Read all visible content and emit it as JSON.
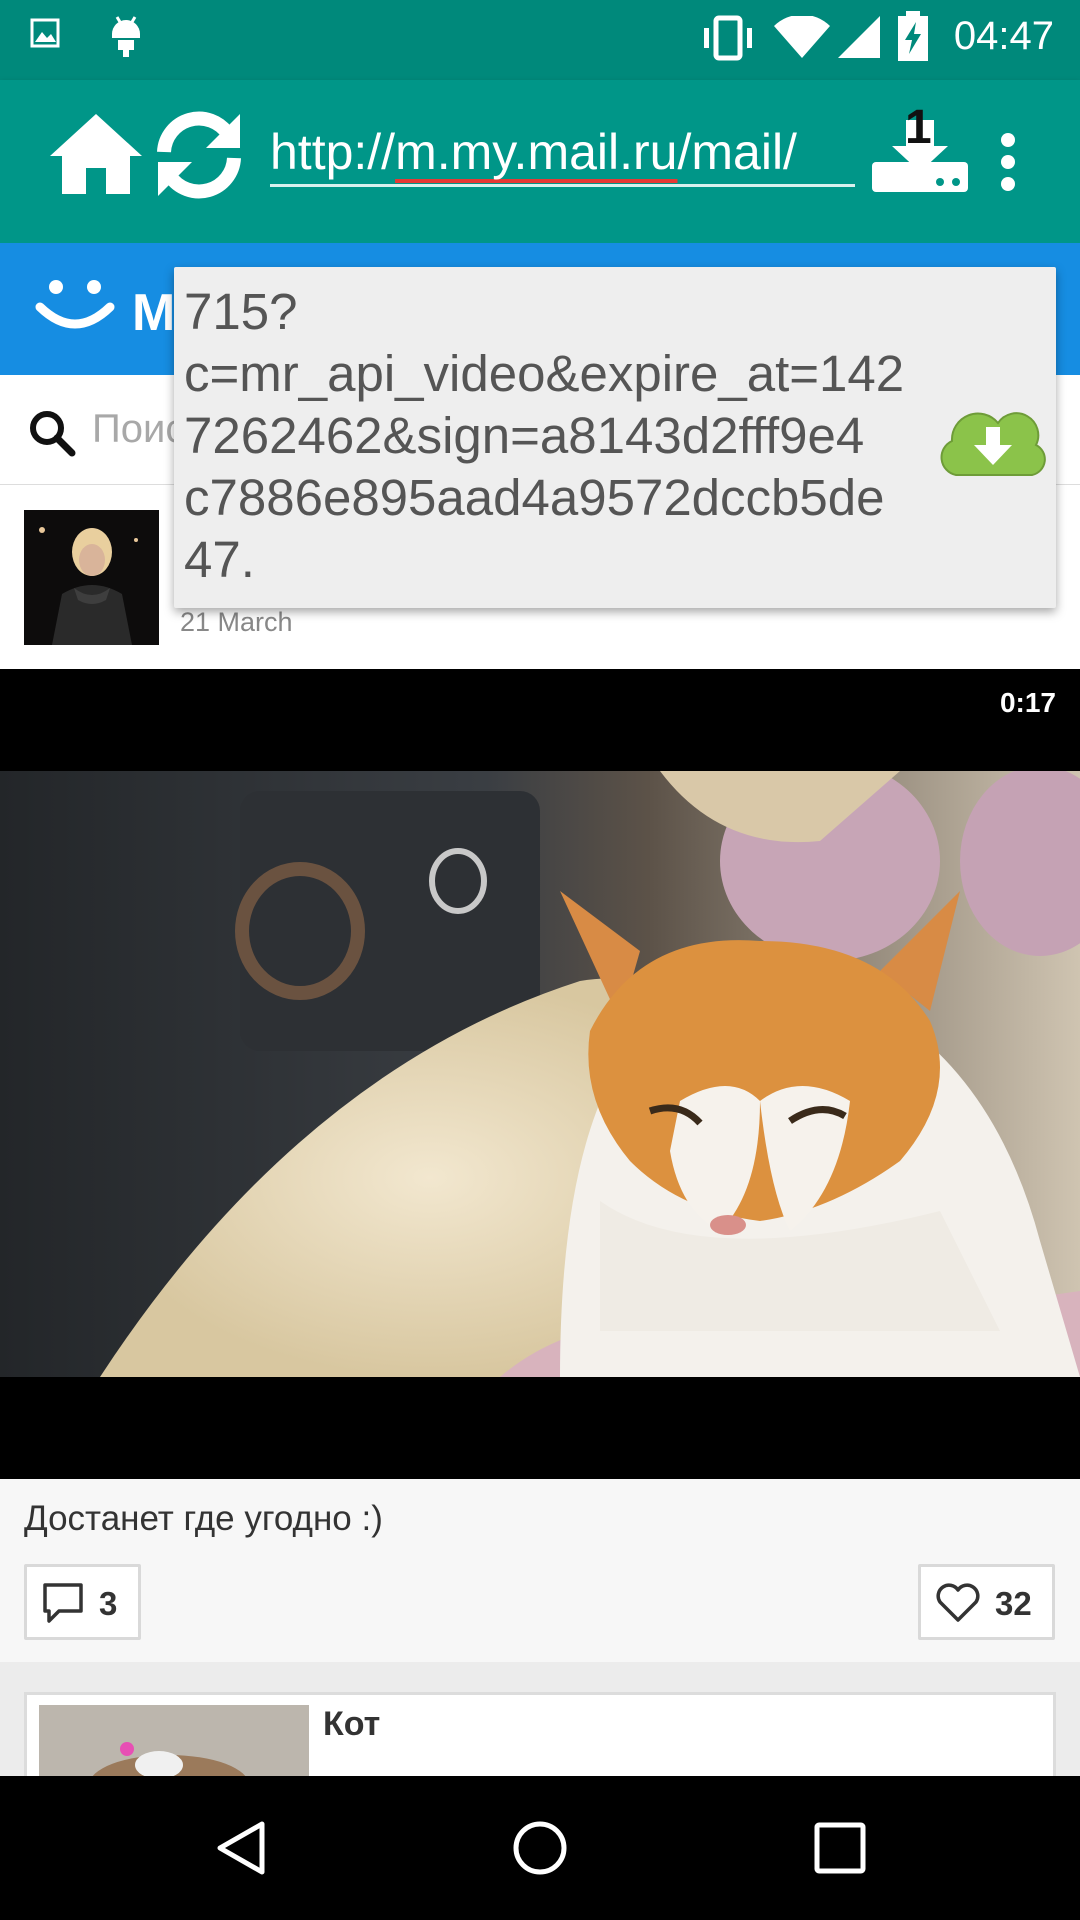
{
  "status_bar": {
    "time": "04:47",
    "icons": [
      "image-icon",
      "android-icon",
      "vibrate-icon",
      "wifi-icon",
      "signal-icon",
      "battery-charging-icon"
    ]
  },
  "toolbar": {
    "home_icon": "home-icon",
    "refresh_icon": "refresh-icon",
    "url_prefix": "http://",
    "url_domain": "m.my.mail.ru",
    "url_suffix": "/mail/",
    "download_count": "1",
    "download_icon": "download-tray-icon",
    "menu_icon": "more-vert-icon"
  },
  "site": {
    "logo_letter": "M",
    "search_placeholder": "Поис"
  },
  "url_popup": {
    "text": "715?\nc=mr_api_video&expire_at=142\n7262462&sign=a8143d2fff9e4\nc7886e895aad4a9572dccb5de\n47.",
    "download_icon": "cloud-download-icon"
  },
  "post": {
    "date": "21 March",
    "duration": "0:17",
    "caption": "Достанет где угодно :)",
    "comments_count": "3",
    "likes_count": "32"
  },
  "next_card": {
    "title": "Кот"
  },
  "colors": {
    "toolbar": "#009688",
    "status_bar": "#00897b",
    "site_header": "#168de2",
    "cloud_green": "#8bc34a"
  }
}
